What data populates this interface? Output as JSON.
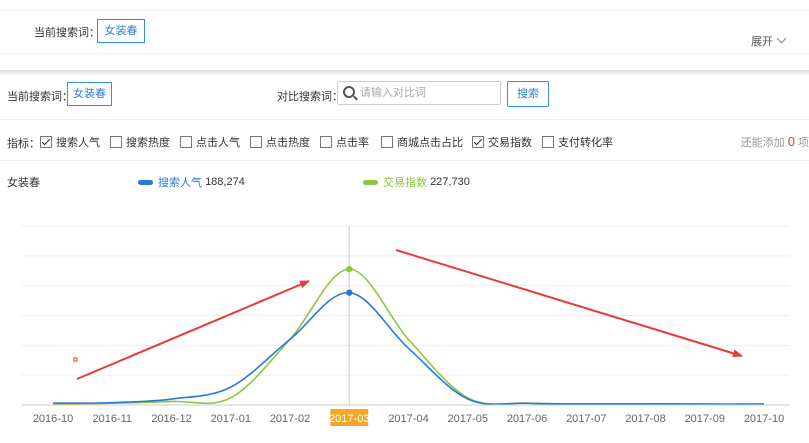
{
  "top": {
    "label": "当前搜索词：",
    "keyword": "女装春",
    "expand": "展开"
  },
  "search": {
    "label": "当前搜索词：",
    "keyword": "女装春",
    "compare_label": "对比搜索词：",
    "compare_placeholder": "请输入对比词",
    "button": "搜索"
  },
  "metrics": {
    "label": "指标：",
    "items": [
      {
        "label": "搜索人气",
        "checked": true
      },
      {
        "label": "搜索热度",
        "checked": false
      },
      {
        "label": "点击人气",
        "checked": false
      },
      {
        "label": "点击热度",
        "checked": false
      },
      {
        "label": "点击率",
        "checked": false
      },
      {
        "label": "商城点击占比",
        "checked": false
      },
      {
        "label": "交易指数",
        "checked": true
      },
      {
        "label": "支付转化率",
        "checked": false
      }
    ],
    "remain_prefix": "还能添加",
    "remain_count": "0",
    "remain_suffix": "项"
  },
  "legend": {
    "keyword": "女装春",
    "series": [
      {
        "name": "搜索人气",
        "value": "188,274",
        "color": "#2b7bd6"
      },
      {
        "name": "交易指数",
        "value": "227,730",
        "color": "#8cc63f"
      }
    ]
  },
  "chart_data": {
    "type": "line",
    "categories": [
      "2016-10",
      "2016-11",
      "2016-12",
      "2017-01",
      "2017-02",
      "2017-03",
      "2017-04",
      "2017-05",
      "2017-06",
      "2017-07",
      "2017-08",
      "2017-09",
      "2017-10"
    ],
    "highlight": "2017-03",
    "ylim": [
      0,
      300000
    ],
    "grid": true,
    "series": [
      {
        "name": "搜索人气",
        "color": "#2b7bd6",
        "values": [
          3000,
          4000,
          10000,
          30000,
          110000,
          188274,
          95000,
          10000,
          3000,
          2000,
          2000,
          1500,
          1500
        ]
      },
      {
        "name": "交易指数",
        "color": "#8cc63f",
        "values": [
          2000,
          3000,
          6000,
          12000,
          110000,
          227730,
          110000,
          12000,
          3000,
          2000,
          2000,
          1500,
          1500
        ]
      }
    ]
  },
  "colors": {
    "accent": "#2f7fd6",
    "highlight": "#f5a623",
    "arrow": "#e83a3a"
  }
}
